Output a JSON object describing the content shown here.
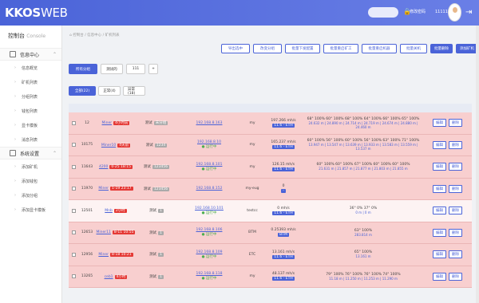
{
  "header": {
    "logo_bold": "KKOS",
    "logo_light": "WEB",
    "change_pwd": "修改密码",
    "user": "111111"
  },
  "sidebar": {
    "title": "控制台",
    "title_en": "Console",
    "sections": [
      {
        "label": "信息中心",
        "items": [
          "信息概览",
          "矿机列表",
          "分组列表",
          "钱包列表",
          "显卡模板",
          "消息列表"
        ]
      },
      {
        "label": "系统设置",
        "items": [
          "添加矿机",
          "添加钱包",
          "添加分组",
          "添加显卡模板"
        ]
      }
    ]
  },
  "breadcrumb": "⌂ 控制台 / 信息中心 / 矿机列表",
  "actions": [
    "导出选中",
    "改变分组",
    "批量下发配置",
    "批量重启矿工",
    "批量重启机器",
    "批量关机"
  ],
  "actions_solid": [
    "批量删除",
    "添加矿机"
  ],
  "groups": [
    "所有分组",
    "测试的",
    "111",
    "+"
  ],
  "status_tabs": [
    "全部(22)",
    "正常(4)",
    "异常(18)"
  ],
  "columns": [
    "ID",
    "名称",
    "分组",
    "IP",
    "钱包",
    "算力(MH/s)",
    "显卡状态",
    "操作"
  ],
  "rows": [
    {
      "id": "12",
      "name": "Miner",
      "tag": "4小时前",
      "group": "测试",
      "grp_tag": "未分组",
      "ip": "192.168.8.163",
      "ip_status": "",
      "wallet": "my",
      "hash": "197.266 mh/s",
      "coin": "11.6 - ETH",
      "gpu1": "68°  100%  60° 100%  68° 100%  64° 100%  66° 100%  65° 100%",
      "gpu2": "24.632 m | 24.890 m | 24.714 m | 24.719 m | 24.674 m | 24.880 m | 24.460 m",
      "white": false
    },
    {
      "id": "10175",
      "name": "Miner10",
      "tag": "4天前",
      "group": "测试",
      "grp_tag": "1234",
      "ip": "192.168.8.10",
      "ip_status": "● 运行中",
      "wallet": "my",
      "hash": "165.237 mh/s",
      "coin": "11.6 - ETH",
      "gpu1": "60° 100%  56° 100%  60° 100%  56° 100%  63° 100%  71° 100%",
      "gpu2": "13.947 m | 13.547 m | 13.639 m | 13.933 m | 13.583 m | 13.559 m | 13.537 m",
      "white": false
    },
    {
      "id": "11643",
      "name": "4200",
      "tag": "0-25 18:15",
      "group": "测试",
      "grp_tag": "123456",
      "ip": "192.168.8.101",
      "ip_status": "● 运行中",
      "wallet": "my",
      "hash": "126.15 mh/s",
      "coin": "11.6 - ETH",
      "gpu1": "60° 100%  60° 100%  67° 100%  60° 100%  60° 100%",
      "gpu2": "21.631 m | 21.857 m | 21.877 m | 21.803 m | 21.855 m",
      "white": false
    },
    {
      "id": "11970",
      "name": "Miner",
      "tag": "1-19 23:17",
      "group": "测试",
      "grp_tag": "123456",
      "ip": "192.168.8.152",
      "ip_status": "",
      "wallet": "my-eug",
      "hash": "0",
      "coin": "-",
      "gpu1": "",
      "gpu2": "",
      "white": false
    },
    {
      "id": "12501",
      "name": "Mnb",
      "tag": "2小时",
      "group": "测试",
      "grp_tag": "1",
      "ip": "192.168.10.101",
      "ip_status": "● 运行中",
      "wallet": "testcc",
      "hash": "0 mh/s",
      "coin": "11.6 - ETH",
      "gpu1": "36° 0%  37° 0%",
      "gpu2": "0 m | 0 m",
      "white": true
    },
    {
      "id": "12653",
      "name": "Miner11",
      "tag": "8-11 10:55",
      "group": "测试",
      "grp_tag": "1",
      "ip": "192.168.8.106",
      "ip_status": "● 运行中",
      "wallet": "BTM",
      "hash": "0.25393 mh/s",
      "coin": "BTM",
      "gpu1": "63° 100%",
      "gpu2": "283.814 m",
      "white": false
    },
    {
      "id": "12956",
      "name": "Miner",
      "tag": "8-18 10:21",
      "group": "测试",
      "grp_tag": "1",
      "ip": "192.168.8.109",
      "ip_status": "● 运行中",
      "wallet": "ETC",
      "hash": "13.161 mh/s",
      "coin": "11.6 - ETH",
      "gpu1": "65° 100%",
      "gpu2": "13.161 m",
      "white": false
    },
    {
      "id": "13265",
      "name": "ceb1",
      "tag": "4小时",
      "group": "测试",
      "grp_tag": "1",
      "ip": "192.168.8.118",
      "ip_status": "● 运行中",
      "wallet": "my",
      "hash": "48.137 mh/s",
      "coin": "11.6 - ETH",
      "gpu1": "79° 100%  76° 100%  76° 100%  74° 100%",
      "gpu2": "11.18 m | 11.250 m | 11.253 m | 11.290 m",
      "white": false
    }
  ],
  "op_edit": "编辑",
  "op_del": "删除"
}
